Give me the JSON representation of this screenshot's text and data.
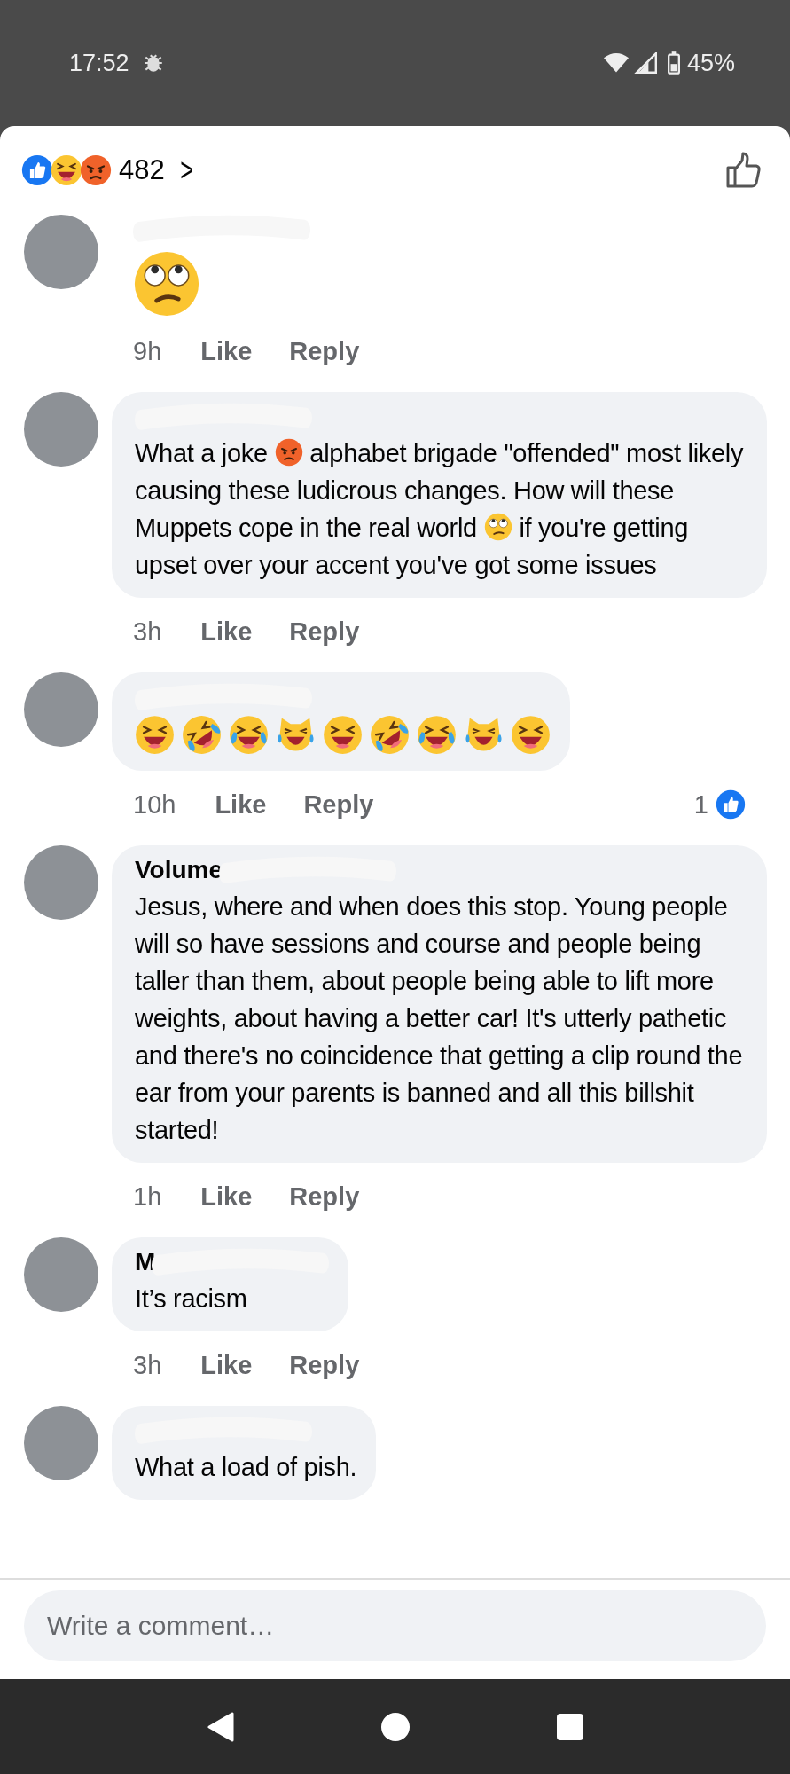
{
  "status_bar": {
    "time": "17:52",
    "battery": "45%"
  },
  "reactions": {
    "count": "482",
    "chevron": ">"
  },
  "comments": [
    {
      "kind": "emoji",
      "body": [
        {
          "kind": "eyeroll"
        }
      ],
      "time": "9h",
      "like": "Like",
      "reply": "Reply"
    },
    {
      "kind": "bubble",
      "body": [
        {
          "kind": "text",
          "text": "What a joke "
        },
        {
          "kind": "angry"
        },
        {
          "kind": "text",
          "text": " alphabet brigade \"offended\" most likely causing these ludicrous changes. How will these Muppets cope in the real world "
        },
        {
          "kind": "eyeroll"
        },
        {
          "kind": "text",
          "text": " if you're getting upset over your accent you've got some issues"
        }
      ],
      "time": "3h",
      "like": "Like",
      "reply": "Reply"
    },
    {
      "kind": "bubble",
      "body": [
        {
          "kind": "grin"
        },
        {
          "kind": "rofl"
        },
        {
          "kind": "joy"
        },
        {
          "kind": "cat"
        },
        {
          "kind": "grin"
        },
        {
          "kind": "rofl"
        },
        {
          "kind": "joy"
        },
        {
          "kind": "cat"
        },
        {
          "kind": "grin"
        }
      ],
      "time": "10h",
      "like": "Like",
      "reply": "Reply",
      "reaction_count": "1"
    },
    {
      "kind": "bubble",
      "name": "Volume",
      "body": [
        {
          "kind": "text",
          "text": "Jesus, where and when does this stop. Young people will so have sessions and course and people being taller than them, about people being able to lift more weights, about having a better car! It's utterly pathetic and there's no coincidence that getting a clip round the ear from your parents is banned and all this billshit started!"
        }
      ],
      "time": "1h",
      "like": "Like",
      "reply": "Reply"
    },
    {
      "kind": "bubble",
      "name": "M",
      "body": [
        {
          "kind": "text",
          "text": "It’s racism"
        }
      ],
      "time": "3h",
      "like": "Like",
      "reply": "Reply"
    },
    {
      "kind": "bubble",
      "body": [
        {
          "kind": "text",
          "text": "What a load of pish."
        }
      ]
    }
  ],
  "composer": {
    "placeholder": "Write a comment…"
  }
}
